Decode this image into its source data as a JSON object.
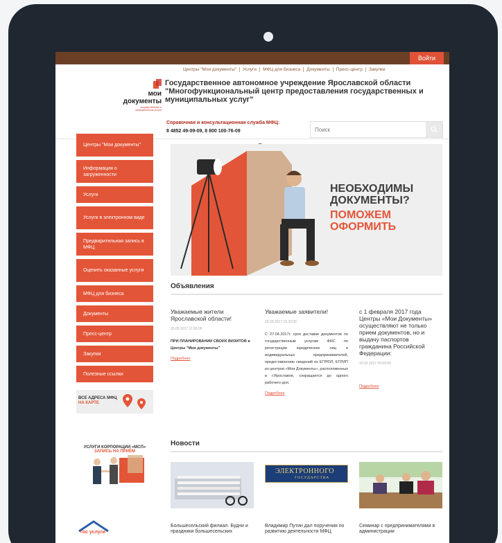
{
  "header": {
    "login_label": "Войти",
    "topnav": [
      "Центры \"Мои документы\"",
      "Услуги",
      "МФЦ для бизнеса",
      "Документы",
      "Пресс-центр",
      "Закупки"
    ],
    "logo_line1": "мои",
    "logo_line2": "документы",
    "logo_small": "государственные и муниципальные услуги",
    "org_name": "Государственное автономное учреждение Ярославской области \"Многофункциональный центр предоставления государственных и муниципальных услуг\"",
    "help_label": "Справочная и консультационная служба МФЦ:",
    "help_phones": "8 4852 49-09-09, 8 800 100-76-09",
    "search_placeholder": "Поиск"
  },
  "notice": "Портал находится в стадии наполнения",
  "sidebar": {
    "items": [
      "Центры \"Мои документы\"",
      "Информация о загруженности",
      "Услуги",
      "Услуги в электронном виде",
      "Предварительная запись в МФЦ",
      "Оценить оказанные услуги",
      "МФЦ для бизнеса",
      "Документы",
      "Пресс-центр",
      "Закупки",
      "Полезные ссылки"
    ],
    "map_line1": "ВСЕ АДРЕСА МФЦ",
    "map_line2": "НА КАРТЕ",
    "msp_line1": "УСЛУГИ КОРПОРАЦИИ «МСП»",
    "msp_line2": "ЗАПИСЬ НА ПРИЁМ",
    "gos_text": "гос услуги"
  },
  "banner": {
    "line1": "НЕОБХОДИМЫ",
    "line2": "ДОКУМЕНТЫ?",
    "line3": "ПОМОЖЕМ",
    "line4": "ОФОРМИТЬ"
  },
  "announcements": {
    "title": "Объявления",
    "items": [
      {
        "title": "Уважаемые жители Ярославской области!",
        "date": "26.05.2017 11:56:00",
        "text": "ПРИ ПЛАНИРОВАНИИ СВОИХ ВИЗИТОВ в Центры \"Мои документы\"",
        "more": "Подробнее"
      },
      {
        "title": "Уважаемые заявители!",
        "date": "26.04.2017 15:23:00",
        "text": "С 27.04.2017г. срок доставки документов по государственным услугам ФНС по регистрации юридических лиц и индивидуальных предпринимателей, предоставлению сведений из ЕГРЮЛ, ЕГРИП из центров «Мои Документы», расположенных в г.Ярославле, сокращается до одного рабочего дня.",
        "more": "Подробнее"
      },
      {
        "title": "с 1 февраля 2017 года Центры «Мои Документы» осуществляют не только прием документов, но и выдачу паспортов гражданина Российской Федерации:",
        "date": "10.02.2017 09:09:00",
        "text": "",
        "more": "Подробнее"
      }
    ]
  },
  "news": {
    "title": "Новости",
    "electronic_logo_line1": "ЭЛЕКТРОННОГО",
    "electronic_logo_line2": "ГОСУДАРСТВА",
    "items": [
      "Большесельский филиал. Будни и праздники большесельских",
      "Владимир Путин дал поручения по развитию деятельности МФЦ",
      "Семинар с предпринимателями в администрации"
    ]
  },
  "colors": {
    "accent": "#e35538",
    "topbar": "#6b3f26",
    "frame": "#1f2731"
  }
}
